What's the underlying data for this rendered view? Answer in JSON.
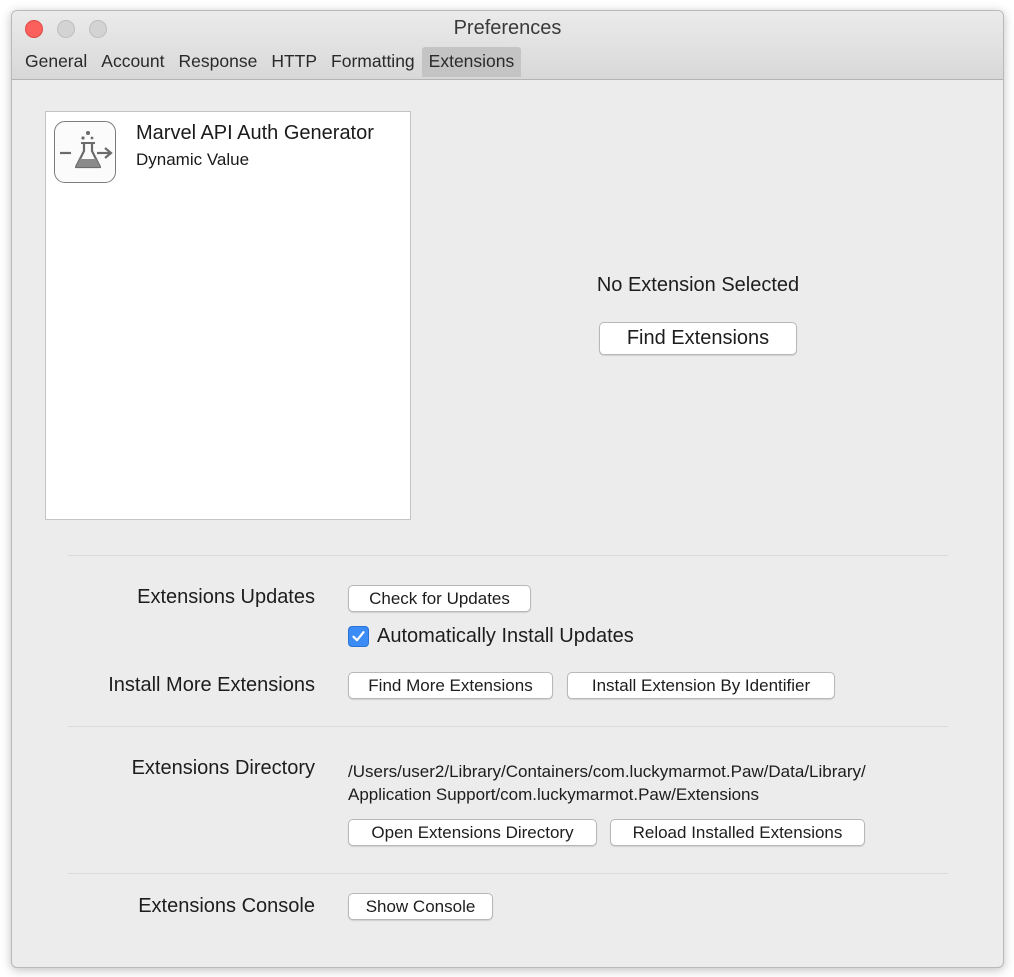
{
  "window": {
    "title": "Preferences",
    "tabs": [
      {
        "label": "General"
      },
      {
        "label": "Account"
      },
      {
        "label": "Response"
      },
      {
        "label": "HTTP"
      },
      {
        "label": "Formatting"
      },
      {
        "label": "Extensions",
        "active": true
      }
    ]
  },
  "extensions_list": {
    "items": [
      {
        "name": "Marvel API Auth Generator",
        "type": "Dynamic Value",
        "icon": "flask-arrow-icon"
      }
    ]
  },
  "detail": {
    "empty_message": "No Extension Selected",
    "find_button": "Find Extensions"
  },
  "updates": {
    "label": "Extensions Updates",
    "check_button": "Check for Updates",
    "auto_install_label": "Automatically Install Updates",
    "auto_install_checked": true
  },
  "install": {
    "label": "Install More Extensions",
    "find_more_button": "Find More Extensions",
    "by_identifier_button": "Install Extension By Identifier"
  },
  "directory": {
    "label": "Extensions Directory",
    "path_line1": "/Users/user2/Library/Containers/com.luckymarmot.Paw/Data/Library/",
    "path_line2": "Application Support/com.luckymarmot.Paw/Extensions",
    "open_button": "Open Extensions Directory",
    "reload_button": "Reload Installed Extensions"
  },
  "console": {
    "label": "Extensions Console",
    "show_button": "Show Console"
  },
  "colors": {
    "accent": "#3b8cf5",
    "close": "#fc605c",
    "window_bg": "#ececec"
  }
}
